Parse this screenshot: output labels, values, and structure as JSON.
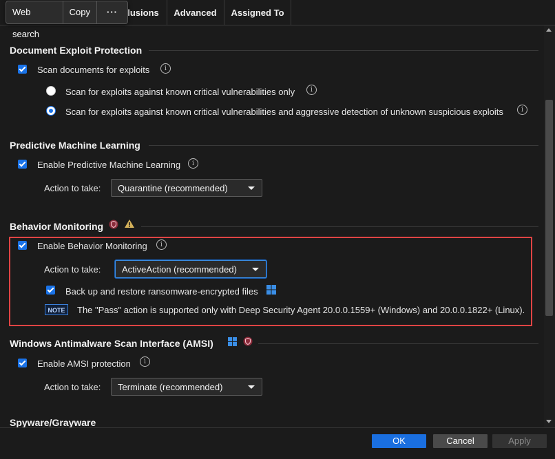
{
  "popup": {
    "web_search": "Web search",
    "copy": "Copy",
    "more": "···"
  },
  "tabs": {
    "partial": "clusions",
    "advanced": "Advanced",
    "assigned_to": "Assigned To"
  },
  "sections": {
    "doc_exploit": {
      "title": "Document Exploit Protection",
      "scan_label": "Scan documents for exploits",
      "option_known": "Scan for exploits against known critical vulnerabilities only",
      "option_aggressive": "Scan for exploits against known critical vulnerabilities and aggressive detection of unknown suspicious exploits"
    },
    "pml": {
      "title": "Predictive Machine Learning",
      "enable_label": "Enable Predictive Machine Learning",
      "action_label": "Action to take:",
      "action_value": "Quarantine (recommended)"
    },
    "behavior": {
      "title": "Behavior Monitoring",
      "enable_label": "Enable Behavior Monitoring",
      "action_label": "Action to take:",
      "action_value": "ActiveAction (recommended)",
      "backup_label": "Back up and restore ransomware-encrypted files",
      "note_badge": "NOTE",
      "note_text": "The \"Pass\" action is supported only with Deep Security Agent 20.0.0.1559+ (Windows) and 20.0.0.1822+ (Linux)."
    },
    "amsi": {
      "title": "Windows Antimalware Scan Interface (AMSI)",
      "enable_label": "Enable AMSI protection",
      "action_label": "Action to take:",
      "action_value": "Terminate (recommended)"
    },
    "spyware": {
      "title": "Spyware/Grayware"
    }
  },
  "footer": {
    "ok": "OK",
    "cancel": "Cancel",
    "apply": "Apply"
  },
  "colors": {
    "accent": "#1a73e8",
    "highlight_border": "#e04444",
    "background": "#1b1b1b"
  },
  "icons": [
    "info-icon",
    "shield-icon",
    "warning-icon",
    "windows-icon"
  ]
}
